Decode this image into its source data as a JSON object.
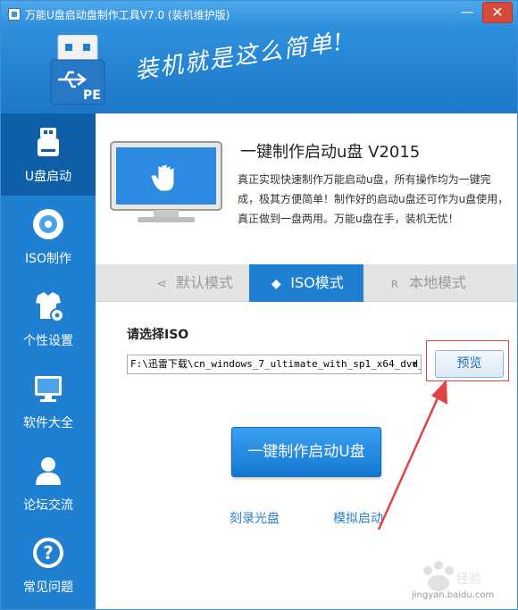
{
  "window": {
    "title": "万能U盘启动盘制作工具V7.0 (装机维护版)",
    "min_glyph": "—",
    "close_glyph": "✕"
  },
  "header": {
    "slogan": "装机就是这么简单!",
    "logo_badge": "PE"
  },
  "sidebar": {
    "items": [
      {
        "label": "U盘启动",
        "icon": "usb-drive-icon",
        "active": true
      },
      {
        "label": "ISO制作",
        "icon": "disc-icon",
        "active": false
      },
      {
        "label": "个性设置",
        "icon": "shirt-gear-icon",
        "active": false
      },
      {
        "label": "软件大全",
        "icon": "monitor-icon",
        "active": false
      },
      {
        "label": "论坛交流",
        "icon": "user-icon",
        "active": false
      },
      {
        "label": "常见问题",
        "icon": "question-icon",
        "active": false
      }
    ]
  },
  "product": {
    "title": "一键制作启动u盘 V2015",
    "description": "真正实现快速制作万能启动u盘，所有操作均为一键完成，极其方便简单！制作好的启动u盘还可作为u盘使用，真正做到一盘两用。万能u盘在手，装机无忧！"
  },
  "tabs": [
    {
      "label": "默认模式",
      "icon": "share-icon",
      "active": false
    },
    {
      "label": "ISO模式",
      "icon": "tag-icon",
      "active": true
    },
    {
      "label": "本地模式",
      "icon": "rss-icon",
      "active": false
    }
  ],
  "iso": {
    "label": "请选择ISO",
    "selected_path": "F:\\迅雷下载\\cn_windows_7_ultimate_with_sp1_x64_dvd_",
    "preview_label": "预览"
  },
  "actions": {
    "make_label": "一键制作启动U盘",
    "burn_label": "刻录光盘",
    "simulate_label": "模拟启动"
  },
  "watermark": {
    "text": "jingyan.baidu.com"
  },
  "colors": {
    "brand_blue": "#1f7fd0",
    "sidebar_active": "#0f5fa8",
    "annotation_red": "#e04545"
  }
}
